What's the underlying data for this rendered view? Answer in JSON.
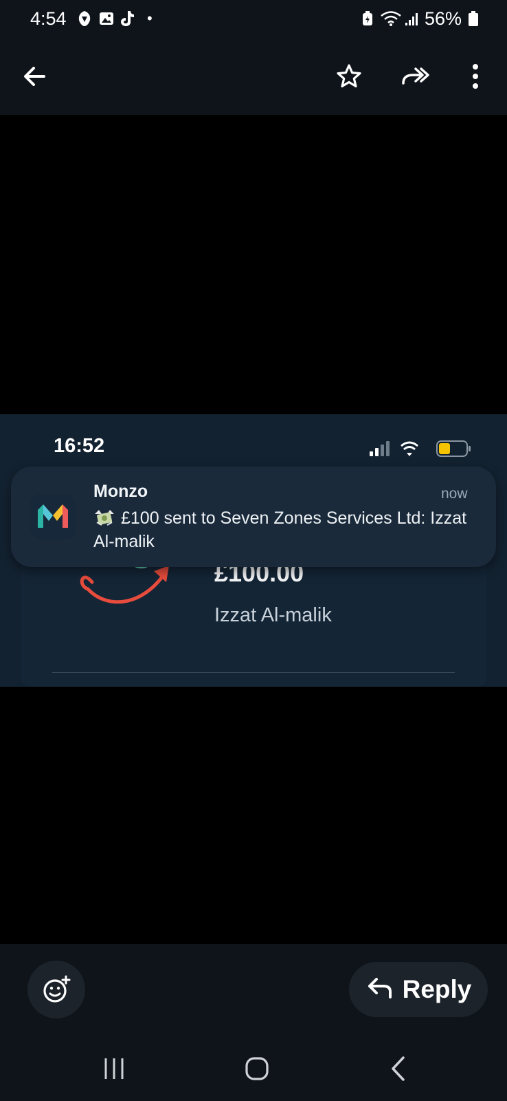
{
  "status_bar": {
    "time": "4:54",
    "battery": "56%",
    "icons": [
      "barclays-icon",
      "gallery-icon",
      "tiktok-icon",
      "notification-dot",
      "battery-saver-icon",
      "wifi-icon",
      "signal-icon",
      "battery-icon"
    ]
  },
  "toolbar": {
    "icons": [
      "back-arrow-icon",
      "star-icon",
      "forward-icon",
      "more-vert-icon"
    ]
  },
  "screenshot": {
    "inner_status": {
      "time": "16:52",
      "battery_color": "#f5c400"
    },
    "notification": {
      "app_name": "Monzo",
      "time": "now",
      "emoji": "money-with-wings-icon",
      "message": "£100 sent to Seven Zones Services Ltd: Izzat Al-malik"
    },
    "card": {
      "amount": "£100.00",
      "payee": "Izzat Al-malik"
    }
  },
  "bottom": {
    "reply_label": "Reply",
    "reaction_icon": "add-reaction-icon"
  },
  "nav": {
    "icons": [
      "recents-icon",
      "home-icon",
      "back-icon"
    ]
  },
  "colors": {
    "bar_background": "#0f141a",
    "image_background": "#132231",
    "notification_background": "#1a2a3b"
  }
}
